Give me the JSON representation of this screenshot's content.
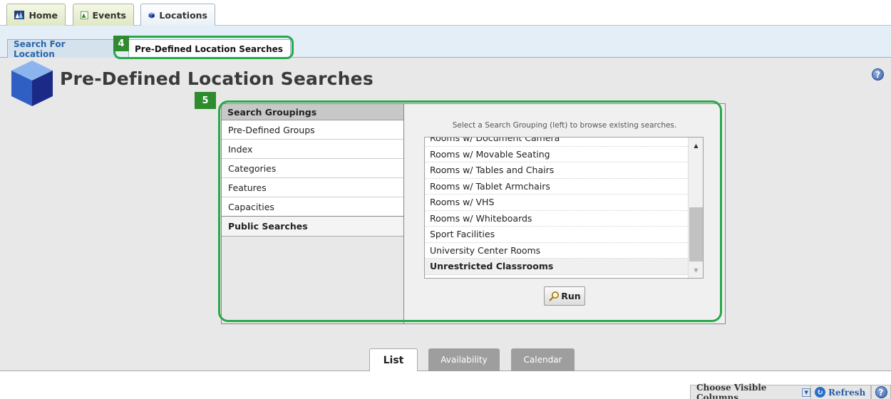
{
  "top_tabs": [
    {
      "label": "Home",
      "icon": "home-icon",
      "active": false
    },
    {
      "label": "Events",
      "icon": "events-icon",
      "active": false
    },
    {
      "label": "Locations",
      "icon": "locations-cube-icon",
      "active": true
    }
  ],
  "sub_tabs": [
    {
      "label": "Search For Location",
      "active": false
    },
    {
      "label": "Pre-Defined Location Searches",
      "active": true
    }
  ],
  "callouts": [
    "4",
    "5"
  ],
  "page": {
    "title": "Pre-Defined Location Searches",
    "help": "?"
  },
  "groupings": {
    "header": "Search Groupings",
    "items": [
      "Pre-Defined Groups",
      "Index",
      "Categories",
      "Features",
      "Capacities"
    ],
    "public": "Public Searches"
  },
  "results": {
    "instruction": "Select a Search Grouping (left) to browse existing searches.",
    "items": [
      "Rooms w/ Document Camera",
      "Rooms w/ Movable Seating",
      "Rooms w/ Tables and Chairs",
      "Rooms w/ Tablet Armchairs",
      "Rooms w/ VHS",
      "Rooms w/ Whiteboards",
      "Sport Facilities",
      "University Center Rooms",
      "Unrestricted Classrooms"
    ],
    "selected": "Unrestricted Classrooms",
    "run_label": "Run",
    "scroll_up": "▲",
    "scroll_down": "▼"
  },
  "view_tabs": [
    {
      "label": "List",
      "active": true
    },
    {
      "label": "Availability",
      "active": false
    },
    {
      "label": "Calendar",
      "active": false
    }
  ],
  "bottom": {
    "columns_label": "Choose Visible Columns",
    "refresh_label": "Refresh",
    "help": "?"
  },
  "colors": {
    "highlight": "#27a94a",
    "callout": "#2e8b2e",
    "link": "#2a66a8"
  }
}
